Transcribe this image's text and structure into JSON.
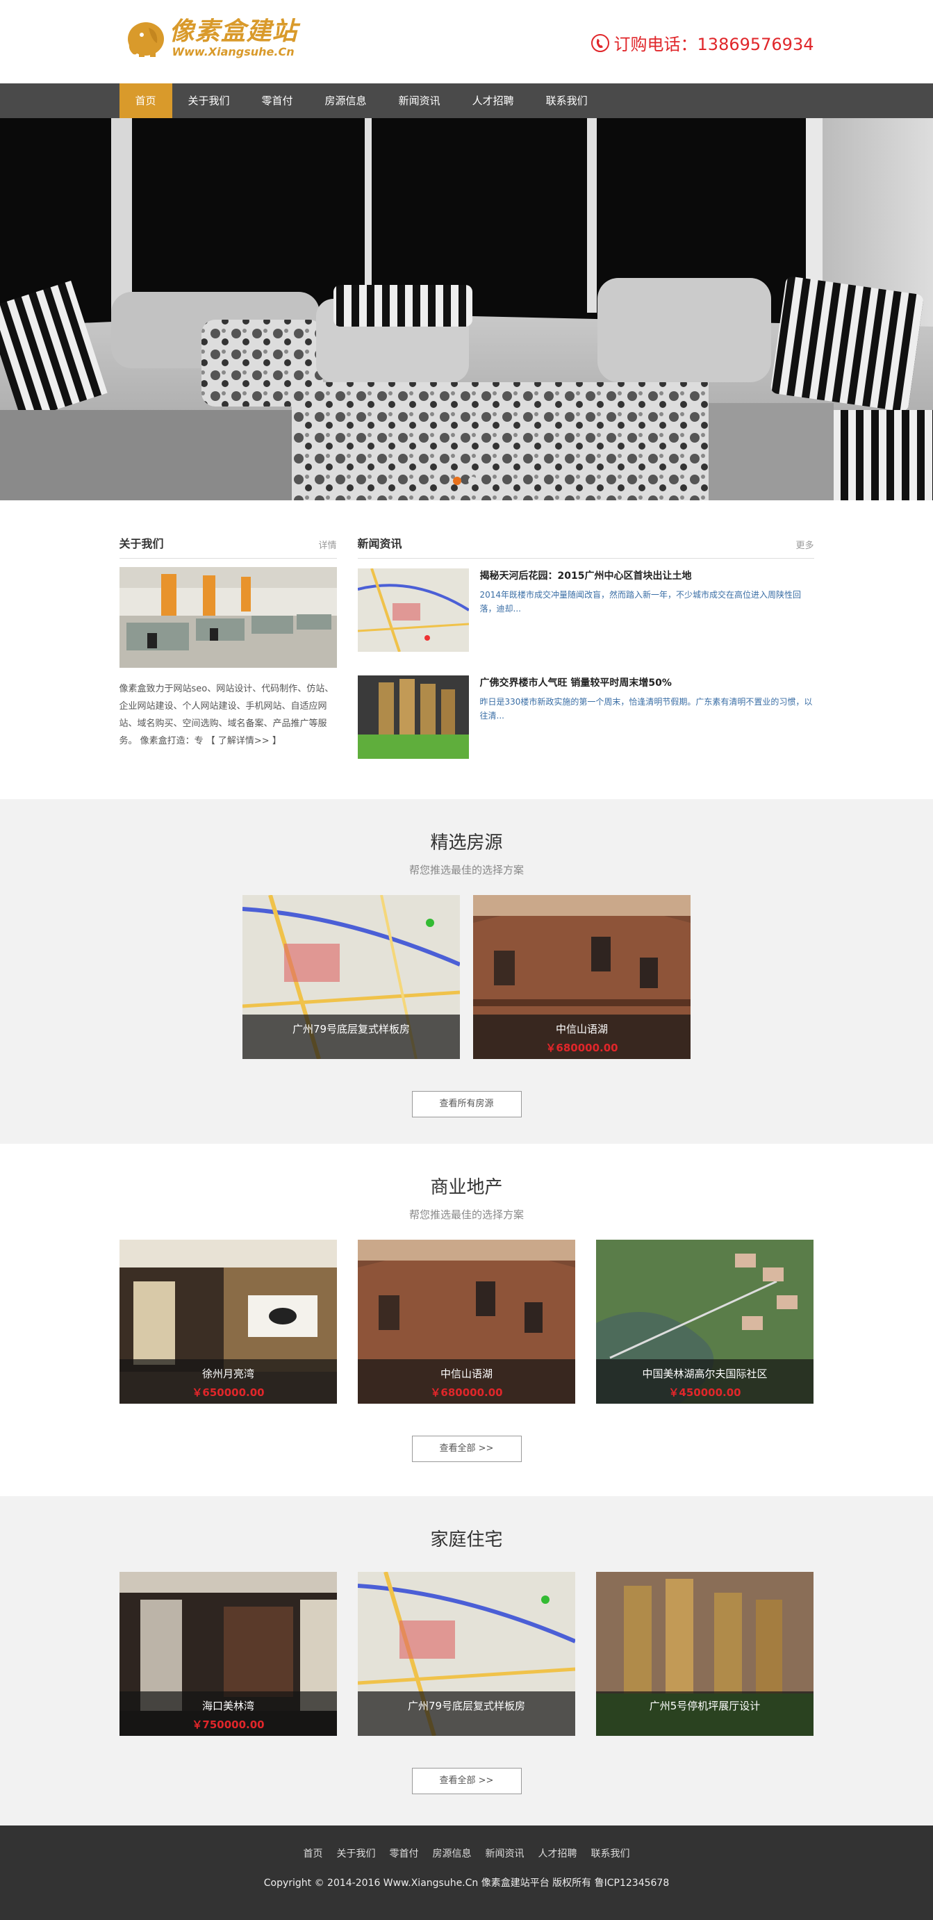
{
  "header": {
    "logo_main": "像素盒建站",
    "logo_sub": "Www.Xiangsuhe.Cn",
    "phone": "订购电话：13869576934"
  },
  "nav": {
    "items": [
      {
        "label": "首页",
        "active": true
      },
      {
        "label": "关于我们"
      },
      {
        "label": "零首付"
      },
      {
        "label": "房源信息"
      },
      {
        "label": "新闻资讯"
      },
      {
        "label": "人才招聘"
      },
      {
        "label": "联系我们"
      }
    ]
  },
  "about": {
    "title": "关于我们",
    "more": "详情",
    "text": "像素盒致力于网站seo、网站设计、代码制作、仿站、企业网站建设、个人网站建设、手机网站、自适应网站、域名购买、空间选购、域名备案、产品推广等服务。 像素盒打造：专 【 了解详情>> 】"
  },
  "news": {
    "title": "新闻资讯",
    "more": "更多",
    "items": [
      {
        "title": "揭秘天河后花园：2015广州中心区首块出让土地",
        "desc": "2014年既楼市成交冲量随闻改盲，然而踏入新一年，不少城市成交在高位进入周陕性回落，迪却..."
      },
      {
        "title": "广佛交界楼市人气旺 销量较平时周末增50%",
        "desc": "昨日是330楼市新政实施的第一个周末，恰逢清明节假期。广东素有清明不置业的习惯，以往清..."
      }
    ]
  },
  "featured": {
    "title": "精选房源",
    "subtitle": "帮您推选最佳的选择方案",
    "items": [
      {
        "name": "广州79号底层复式样板房",
        "price": ""
      },
      {
        "name": "中信山语湖",
        "price": "￥680000.00"
      }
    ],
    "button": "查看所有房源"
  },
  "commercial": {
    "title": "商业地产",
    "subtitle": "帮您推选最佳的选择方案",
    "items": [
      {
        "name": "徐州月亮湾",
        "price": "￥650000.00"
      },
      {
        "name": "中信山语湖",
        "price": "￥680000.00"
      },
      {
        "name": "中国美林湖高尔夫国际社区",
        "price": "￥450000.00"
      }
    ],
    "button": "查看全部 >>"
  },
  "family": {
    "title": "家庭住宅",
    "items": [
      {
        "name": "海口美林湾",
        "price": "￥750000.00"
      },
      {
        "name": "广州79号底层复式样板房",
        "price": ""
      },
      {
        "name": "广州5号停机坪展厅设计",
        "price": ""
      }
    ],
    "button": "查看全部 >>"
  },
  "footer": {
    "links": [
      "首页",
      "关于我们",
      "零首付",
      "房源信息",
      "新闻资讯",
      "人才招聘",
      "联系我们"
    ],
    "copyright": "Copyright © 2014-2016 Www.Xiangsuhe.Cn 像素盒建站平台 版权所有  鲁ICP12345678"
  },
  "colors": {
    "accent": "#d99a2b",
    "nav_bg": "#4a4a4a",
    "price": "#e0262a",
    "footer_bg": "#333333"
  }
}
